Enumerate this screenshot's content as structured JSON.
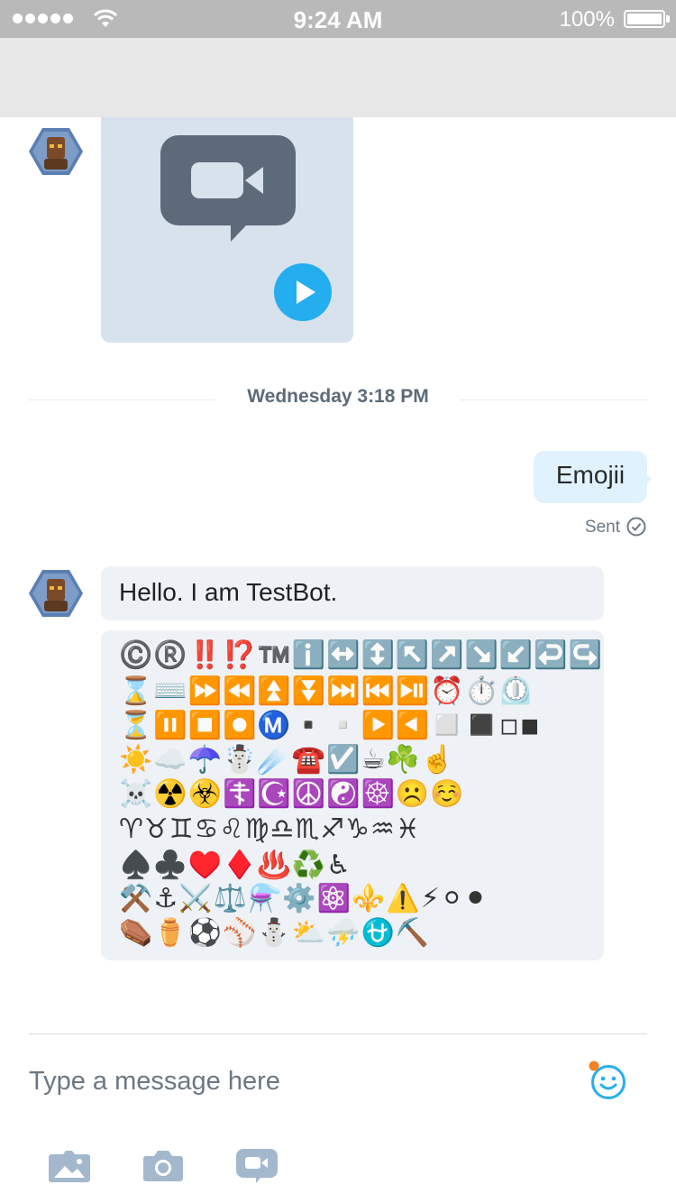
{
  "status_bar": {
    "time": "9:24 AM",
    "battery_pct": "100%"
  },
  "conversation": {
    "date_separator": "Wednesday 3:18 PM",
    "sent_message": {
      "text": "Emojii",
      "status": "Sent"
    },
    "bot_message": {
      "text": "Hello. I am TestBot."
    },
    "emoji_rows": [
      "©️®️‼️⁉️™️ℹ️↔️↕️↖️↗️↘️↙️↩️↪️⌚",
      "⌛⌨️⏩⏪⏫⏬⏭️⏮️⏯️⏰⏱️⏲️",
      "⏳⏸️⏹️⏺️Ⓜ️▪️▫️▶️◀️◻️◼️◽◾",
      "☀️☁️☂️☃️☄️☎️☑️☕☘️☝️",
      "☠️☢️☣️☦️☪️☮️☯️☸️☹️☺️",
      "♈♉♊♋♌♍♎♏♐♑♒♓",
      "♠️♣️♥️♦️♨️♻️♿",
      "⚒️⚓⚔️⚖️⚗️⚙️⚛️⚜️⚠️⚡⚪⚫",
      "⚰️⚱️⚽⚾⛄⛅⛈️⛎⛏️"
    ]
  },
  "composer": {
    "placeholder": "Type a message here"
  },
  "colors": {
    "accent": "#24aef0",
    "sent_bubble": "#dff2fd",
    "received_bubble": "#eef2f7",
    "notification_dot": "#f58220"
  }
}
